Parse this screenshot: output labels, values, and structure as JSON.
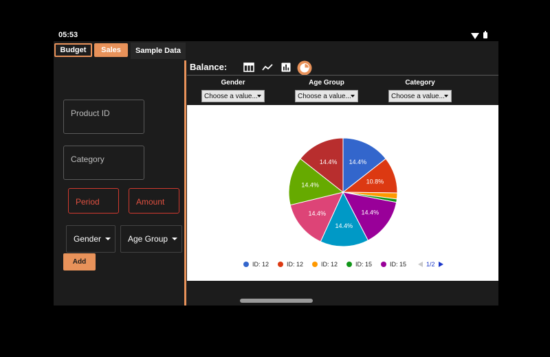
{
  "status": {
    "time": "05:53"
  },
  "tabs": [
    {
      "label": "Budget"
    },
    {
      "label": "Sales"
    },
    {
      "label": "Sample Data"
    }
  ],
  "form": {
    "product_id_label": "Product ID",
    "category_label": "Category",
    "period_label": "Period",
    "amount_label": "Amount",
    "gender_label": "Gender",
    "age_group_label": "Age Group",
    "add_label": "Add"
  },
  "toolbar": {
    "title": "Balance:",
    "icons": [
      "table-icon",
      "line-chart-icon",
      "bar-chart-icon",
      "pie-chart-icon"
    ]
  },
  "filters": [
    {
      "label": "Gender",
      "placeholder": "Choose a value..."
    },
    {
      "label": "Age Group",
      "placeholder": "Choose a value..."
    },
    {
      "label": "Category",
      "placeholder": "Choose a value..."
    }
  ],
  "chart_data": {
    "type": "pie",
    "slices": [
      {
        "value": 14.4,
        "label": "14.4%",
        "color": "#3366cc"
      },
      {
        "value": 10.8,
        "label": "10.8%",
        "color": "#dc3912"
      },
      {
        "value": 1.8,
        "label": "",
        "color": "#ff9900"
      },
      {
        "value": 1.0,
        "label": "",
        "color": "#109618"
      },
      {
        "value": 14.4,
        "label": "14.4%",
        "color": "#990099"
      },
      {
        "value": 14.4,
        "label": "14.4%",
        "color": "#0099c6"
      },
      {
        "value": 14.4,
        "label": "14.4%",
        "color": "#dd4477"
      },
      {
        "value": 14.4,
        "label": "14.4%",
        "color": "#66aa00"
      },
      {
        "value": 14.4,
        "label": "14.4%",
        "color": "#b82e2e"
      }
    ],
    "legend": [
      {
        "name": "ID: 12",
        "color": "#3366cc"
      },
      {
        "name": "ID: 12",
        "color": "#dc3912"
      },
      {
        "name": "ID: 12",
        "color": "#ff9900"
      },
      {
        "name": "ID: 15",
        "color": "#109618"
      },
      {
        "name": "ID: 15",
        "color": "#990099"
      }
    ],
    "page": "1/2"
  },
  "colors": {
    "accent": "#e8925a",
    "error": "#d23a2f"
  }
}
